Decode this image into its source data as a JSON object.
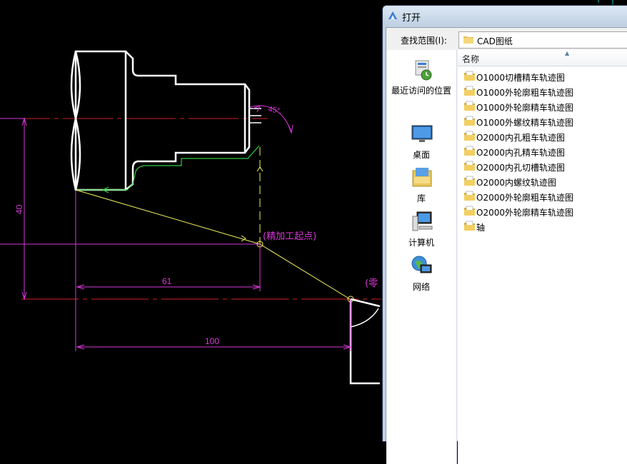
{
  "cad": {
    "dim_40": "40",
    "dim_61": "61",
    "dim_100": "100",
    "angle": "45°",
    "finish_start": "(精加工起点)",
    "zero_point": "(零"
  },
  "dialog": {
    "title": "打开",
    "look_in_label": "查找范围(I):",
    "look_in_value": "CAD图纸",
    "column_name": "名称",
    "places": [
      {
        "label": "最近访问的位置",
        "icon": "recent-places-icon"
      },
      {
        "label": "桌面",
        "icon": "desktop-icon"
      },
      {
        "label": "库",
        "icon": "libraries-icon"
      },
      {
        "label": "计算机",
        "icon": "computer-icon"
      },
      {
        "label": "网络",
        "icon": "network-icon"
      }
    ],
    "files": [
      "O1000切槽精车轨迹图",
      "O1000外轮廓粗车轨迹图",
      "O1000外轮廓精车轨迹图",
      "O1000外螺纹精车轨迹图",
      "O2000内孔粗车轨迹图",
      "O2000内孔精车轨迹图",
      "O2000内孔切槽轨迹图",
      "O2000内螺纹轨迹图",
      "O2000外轮廓粗车轨迹图",
      "O2000外轮廓精车轨迹图",
      "轴"
    ]
  }
}
